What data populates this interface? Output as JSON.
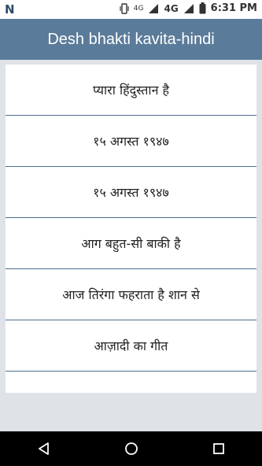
{
  "status_bar": {
    "time": "6:31 PM",
    "network_label": "4G",
    "data_label": "4G",
    "app_logo": "N",
    "icons": [
      "vibrate-icon",
      "signal-icon",
      "battery-icon"
    ]
  },
  "header": {
    "title": "Desh bhakti kavita-hindi"
  },
  "list": {
    "items": [
      {
        "label": "प्यारा हिंदुस्तान है"
      },
      {
        "label": "१५ अगस्त १९४७"
      },
      {
        "label": "१५ अगस्त १९४७"
      },
      {
        "label": "आग बहुत-सी बाकी है"
      },
      {
        "label": "आज तिरंगा फहराता है शान से"
      },
      {
        "label": "आज़ादी का गीत"
      },
      {
        "label": "…"
      }
    ]
  },
  "nav_bar": {
    "icons": [
      "back-icon",
      "home-icon",
      "recents-icon"
    ]
  },
  "colors": {
    "app_bar": "#5b7b9a",
    "divider": "#4d6e8e",
    "background": "#dfe3e8"
  }
}
